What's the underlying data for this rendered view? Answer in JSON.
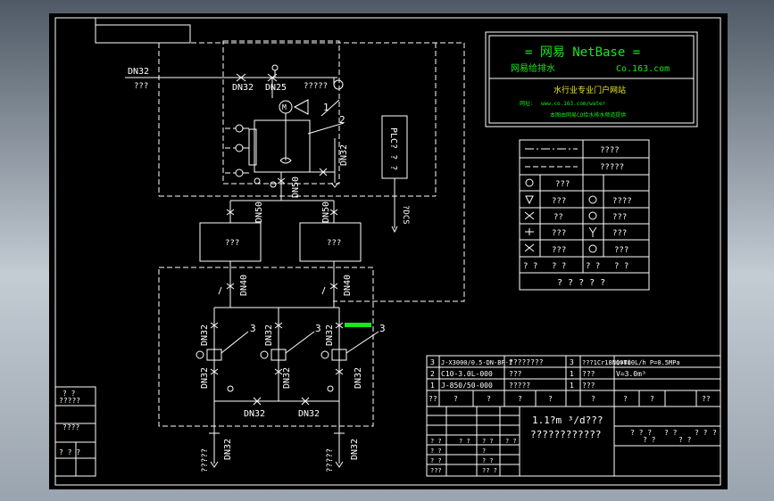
{
  "netbase": {
    "title": "=  网易 NetBase  =",
    "sub_left": "网易给排水",
    "sub_right": "Co.163.com",
    "line1": "水行业专业门户网站",
    "line2": "网址: ",
    "line2_url": "www.co.163.com/water",
    "line3": "本图由网易CO给水排水频道提供"
  },
  "pipe": {
    "dn32_top": "DN32",
    "q_left": "???",
    "dn32_a": "DN32",
    "dn25": "DN25",
    "q_meter": "?????",
    "m_label": "M",
    "num1": "1",
    "num2": "2",
    "dn32_v": "DN32",
    "dn50_v": "DN50",
    "plc": "PLC? ? ?",
    "dn50_l": "DN50",
    "dn50_r": "DN50",
    "dcs": "?DCS",
    "tank_l": "???",
    "tank_r": "???",
    "dn40_l": "DN40",
    "dn40_r": "DN40",
    "dn32_p1": "DN32",
    "dn32_p2": "DN32",
    "dn32_p3": "DN32",
    "dn32_b1": "DN32",
    "dn32_b2": "DN32",
    "dn32_b3": "DN32",
    "num3a": "3",
    "num3b": "3",
    "num3c": "3",
    "dn32_h1": "DN32",
    "dn32_h2": "DN32",
    "dn32_o1": "DN32",
    "dn32_o2": "DN32",
    "q_o1": "?????",
    "q_o2": "?????"
  },
  "legend": {
    "r1": "????",
    "r2": "?????",
    "r3a": "???",
    "r4a": "???",
    "r4b": "????",
    "r5a": "??",
    "r5b": "???",
    "r6a": "???",
    "r6b": "???",
    "r7a": "???",
    "r7b": "???",
    "r8a": "? ?",
    "r8b": "? ?",
    "r8c": "? ?",
    "r8d": "? ?",
    "footer": "? ? ? ? ?"
  },
  "bom": {
    "rows": [
      {
        "no": "3",
        "name": "J-X3000/0.5-DN-BF-I",
        "qty_desc": "????????",
        "no2": "3",
        "spec": "???1Cr18Ni9Ti",
        "rem": "Q=800L/h P=0.5MPa"
      },
      {
        "no": "2",
        "name": "C10-3.0L-000",
        "qty_desc": "???",
        "no2": "1",
        "spec": "???",
        "rem": "V=3.0m³"
      },
      {
        "no": "1",
        "name": "J-850/50-000",
        "qty_desc": "?????",
        "no2": "1",
        "spec": "???",
        "rem": ""
      }
    ],
    "header": [
      "??",
      "?",
      "?",
      "?",
      "?",
      "?",
      "?",
      "?",
      "??"
    ]
  },
  "title_block": {
    "line1": "1.1?m ³/d???",
    "line2": "????????????",
    "tr": [
      "? ? ?",
      "? ?",
      "? ?",
      "?"
    ],
    "rows": [
      "? ?",
      "? ?",
      "? ?",
      "? ?",
      "???",
      "?? ?"
    ],
    "cols": [
      "? ?",
      "? ?",
      "? ?",
      "?"
    ],
    "right_vals": [
      "? ?",
      "? ?"
    ]
  },
  "left_stamp": {
    "a": "? ?",
    "b": "?????",
    "c": "????",
    "d": "? ? ?"
  }
}
